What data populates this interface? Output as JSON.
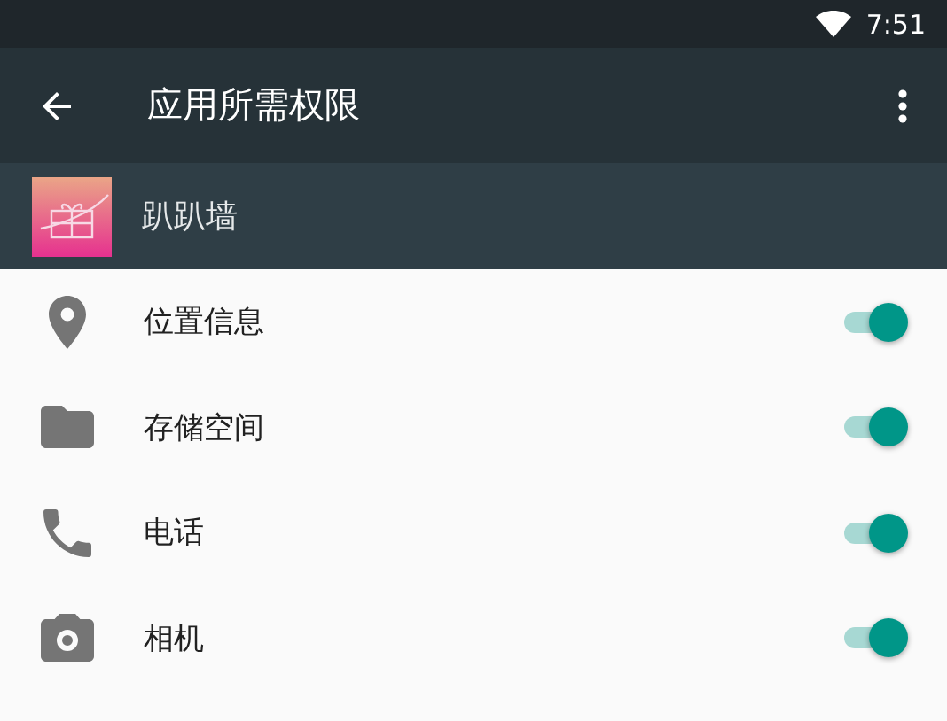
{
  "status_bar": {
    "time": "7:51"
  },
  "toolbar": {
    "title": "应用所需权限"
  },
  "app": {
    "name": "趴趴墙"
  },
  "permissions": [
    {
      "kind": "location",
      "label": "位置信息",
      "on": true
    },
    {
      "kind": "storage",
      "label": "存储空间",
      "on": true
    },
    {
      "kind": "phone",
      "label": "电话",
      "on": true
    },
    {
      "kind": "camera",
      "label": "相机",
      "on": true
    }
  ]
}
